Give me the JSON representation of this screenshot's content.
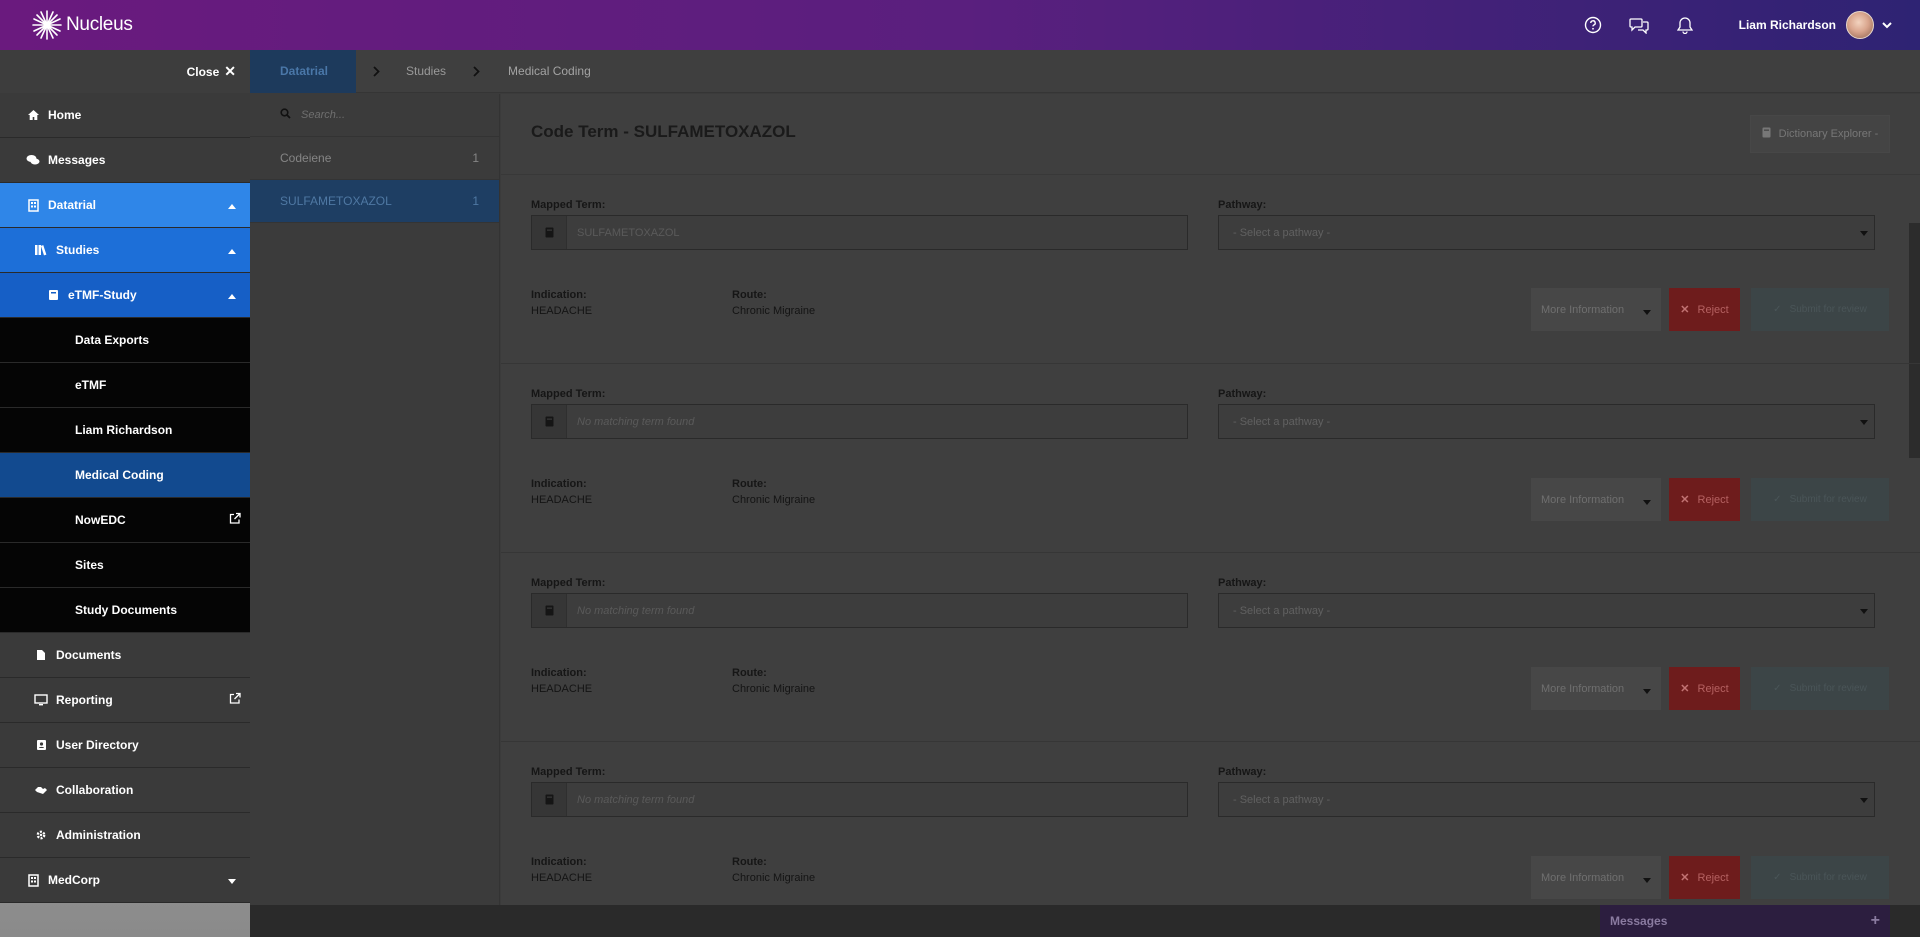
{
  "app": {
    "name": "Nucleus"
  },
  "user": {
    "name": "Liam Richardson"
  },
  "sidebar": {
    "close_label": "Close",
    "items": [
      {
        "label": "Home"
      },
      {
        "label": "Messages"
      },
      {
        "label": "Datatrial"
      },
      {
        "label": "Studies"
      },
      {
        "label": "eTMF-Study"
      },
      {
        "label": "Data Exports"
      },
      {
        "label": "eTMF"
      },
      {
        "label": "Liam Richardson"
      },
      {
        "label": "Medical Coding"
      },
      {
        "label": "NowEDC"
      },
      {
        "label": "Sites"
      },
      {
        "label": "Study Documents"
      },
      {
        "label": "Documents"
      },
      {
        "label": "Reporting"
      },
      {
        "label": "User Directory"
      },
      {
        "label": "Collaboration"
      },
      {
        "label": "Administration"
      },
      {
        "label": "MedCorp"
      }
    ]
  },
  "breadcrumb": {
    "first": "Datatrial",
    "second": "Studies",
    "current": "Medical Coding"
  },
  "search": {
    "placeholder": "Search..."
  },
  "terms_list": [
    {
      "name": "Codeiene",
      "count": "1"
    },
    {
      "name": "SULFAMETOXAZOL",
      "count": "1"
    }
  ],
  "detail": {
    "title": "Code Term - SULFAMETOXAZOL",
    "dictionary_button": "Dictionary Explorer -",
    "mapped_term_label": "Mapped Term:",
    "pathway_label": "Pathway:",
    "indication_label": "Indication:",
    "route_label": "Route:",
    "more_info_label": "More Information",
    "reject_label": "Reject",
    "submit_label": "Submit for review",
    "cards": [
      {
        "mapped_value": "SULFAMETOXAZOL",
        "pathway_value": "- Select a pathway -",
        "indication": "HEADACHE",
        "route": "Chronic Migraine"
      },
      {
        "mapped_value": "No matching term found",
        "pathway_value": "- Select a pathway -",
        "indication": "HEADACHE",
        "route": "Chronic Migraine"
      },
      {
        "mapped_value": "No matching term found",
        "pathway_value": "- Select a pathway -",
        "indication": "HEADACHE",
        "route": "Chronic Migraine"
      },
      {
        "mapped_value": "No matching term found",
        "pathway_value": "- Select a pathway -",
        "indication": "HEADACHE",
        "route": "Chronic Migraine"
      }
    ]
  },
  "messages_bar": {
    "label": "Messages"
  }
}
